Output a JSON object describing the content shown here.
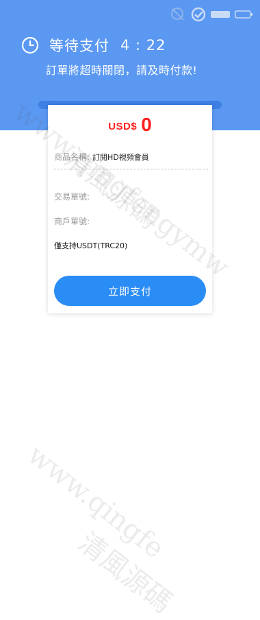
{
  "status_bar": {
    "icons": [
      "signal-icon",
      "alarm-icon",
      "vpn-icon",
      "battery-icon"
    ]
  },
  "header": {
    "title": "等待支付",
    "timer": "4 : 22",
    "subtitle": "訂單將超時關閉，請及時付款!"
  },
  "card": {
    "currency": "USD$",
    "amount": "0",
    "product_label": "商品名稱:",
    "product_value": "訂閱HD視頻會員",
    "transaction_label": "交易單號:",
    "merchant_label": "商戶單號:",
    "note": "僅支持USDT(TRC20)",
    "pay_button": "立即支付"
  },
  "watermark": {
    "text1": "www.qingfengymw",
    "text2": "清風源碼",
    "text3": "www.qingfe"
  },
  "colors": {
    "header_bg": "#5a98f2",
    "amount_red": "#ff1f1f",
    "button_blue": "#2a8cf5"
  }
}
